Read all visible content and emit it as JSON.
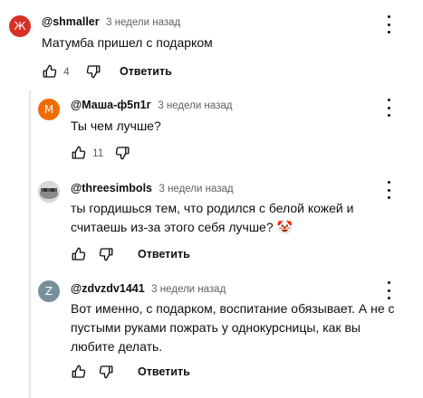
{
  "comments": [
    {
      "avatar_letter": "Ж",
      "avatar_color": "#d93025",
      "author": "@shmaller",
      "time": "3 недели назад",
      "text": "Матумба пришел с подарком",
      "likes": "4",
      "reply_label": "Ответить"
    },
    {
      "avatar_letter": "M",
      "avatar_color": "#ef6c00",
      "author": "@Маша-ф5п1г",
      "time": "3 недели назад",
      "text": "Ты чем лучше?",
      "likes": "11",
      "reply_label": ""
    },
    {
      "avatar_letter": "",
      "avatar_color": "#9e9e9e",
      "author": "@threesimbols",
      "time": "3 недели назад",
      "text": "ты гордишься тем, что родился с белой кожей и считаешь из-за этого себя лучше? 🤡",
      "likes": "",
      "reply_label": "Ответить"
    },
    {
      "avatar_letter": "Z",
      "avatar_color": "#78909c",
      "author": "@zdvzdv1441",
      "time": "3 недели назад",
      "text": "Вот именно, с подарком, воспитание обязывает. А не с пустыми руками пожрать у однокурсницы, как вы любите делать.",
      "likes": "",
      "reply_label": "Ответить"
    }
  ],
  "icons": {
    "like": "thumbs-up-icon",
    "dislike": "thumbs-down-icon",
    "menu": "more-vertical-icon"
  }
}
